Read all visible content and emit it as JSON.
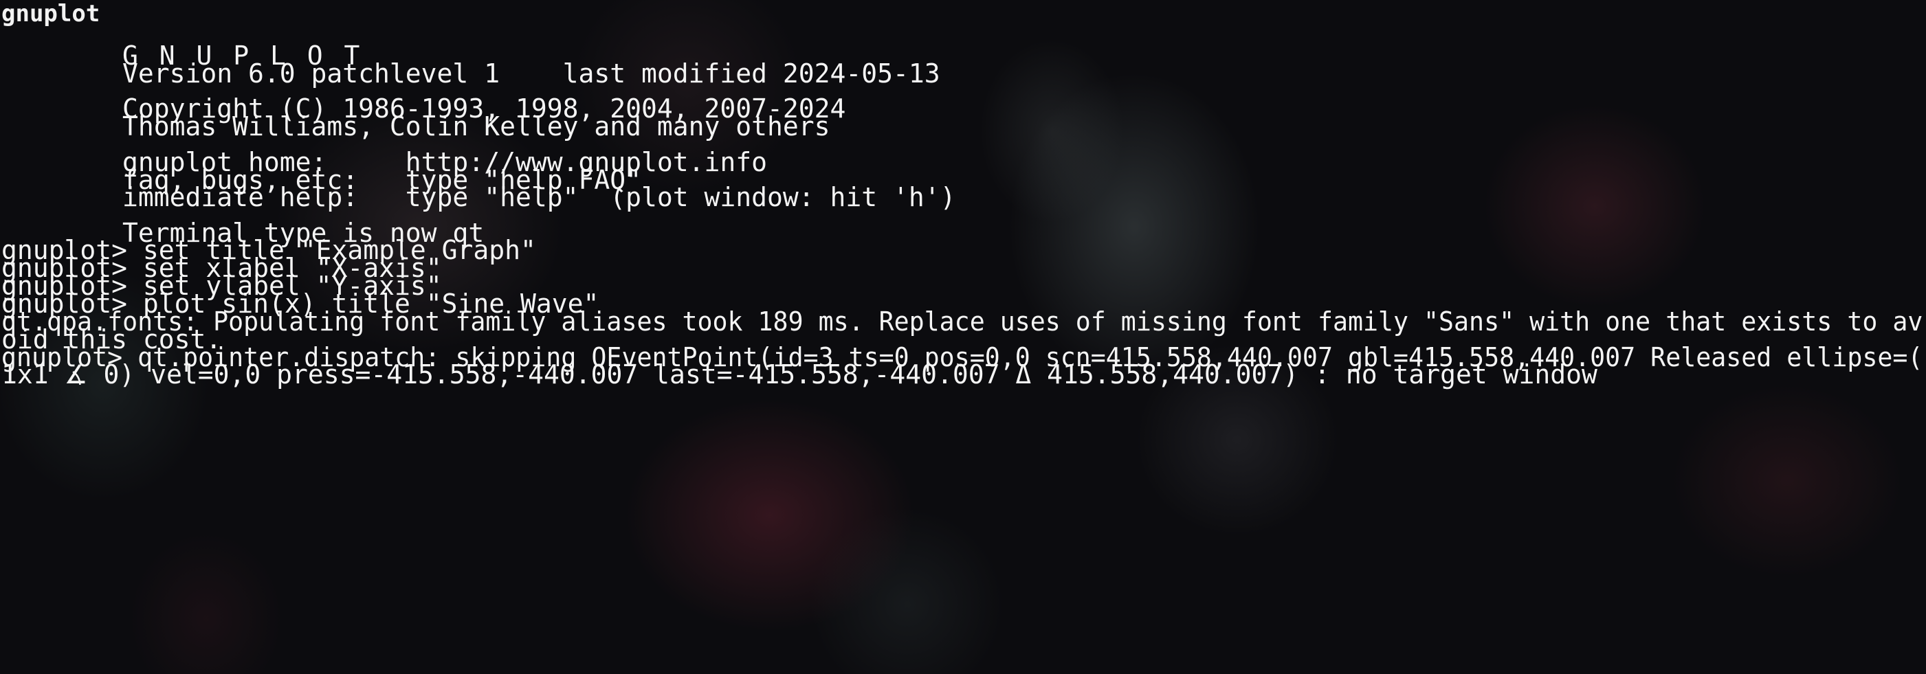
{
  "window": {
    "title": "gnuplot"
  },
  "banner": {
    "name": "G N U P L O T",
    "version_line": "Version 6.0 patchlevel 1    last modified 2024-05-13",
    "copyright_line": "Copyright (C) 1986-1993, 1998, 2004, 2007-2024",
    "authors_line": "Thomas Williams, Colin Kelley and many others",
    "home_line": "gnuplot home:     http://www.gnuplot.info",
    "faq_line": "faq, bugs, etc:   type \"help FAQ\"",
    "help_line": "immediate help:   type \"help\"  (plot window: hit 'h')",
    "terminal_line": "Terminal type is now qt"
  },
  "session": {
    "prompt": "gnuplot>",
    "commands": [
      "set title \"Example Graph\"",
      "set xlabel \"X-axis\"",
      "set ylabel \"Y-axis\"",
      "plot sin(x) title \"Sine Wave\""
    ],
    "output_lines": [
      "qt.qpa.fonts: Populating font family aliases took 189 ms. Replace uses of missing font family \"Sans\" with one that exists to av",
      "oid this cost.",
      "gnuplot> qt.pointer.dispatch: skipping QEventPoint(id=3 ts=0 pos=0,0 scn=415.558,440.007 gbl=415.558,440.007 Released ellipse=(",
      "1x1 ∡ 0) vel=0,0 press=-415.558,-440.007 last=-415.558,-440.007 Δ 415.558,440.007) : no target window"
    ]
  },
  "theme": {
    "text_color": "#f4f4f4",
    "background": "#0c0c0f"
  }
}
